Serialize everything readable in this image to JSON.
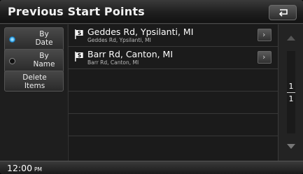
{
  "header": {
    "title": "Previous Start Points",
    "back_icon": "return-arrow-icon"
  },
  "sidebar": {
    "by_date": {
      "line1": "By",
      "line2": "Date",
      "selected": true
    },
    "by_name": {
      "line1": "By",
      "line2": "Name",
      "selected": false
    },
    "delete": {
      "line1": "Delete",
      "line2": "Items"
    }
  },
  "list": {
    "items": [
      {
        "name": "Geddes Rd, Ypsilanti, MI",
        "detail": "Geddes Rd, Ypsilanti, MI",
        "icon": "start-flag-icon"
      },
      {
        "name": "Barr Rd, Canton, MI",
        "detail": "Barr Rd, Canton, MI",
        "icon": "start-flag-icon"
      }
    ]
  },
  "pagination": {
    "current": "1",
    "total": "1"
  },
  "status": {
    "time": "12:00",
    "ampm": "PM"
  },
  "colors": {
    "accent": "#2aa0e8",
    "background": "#1b1b1b"
  }
}
